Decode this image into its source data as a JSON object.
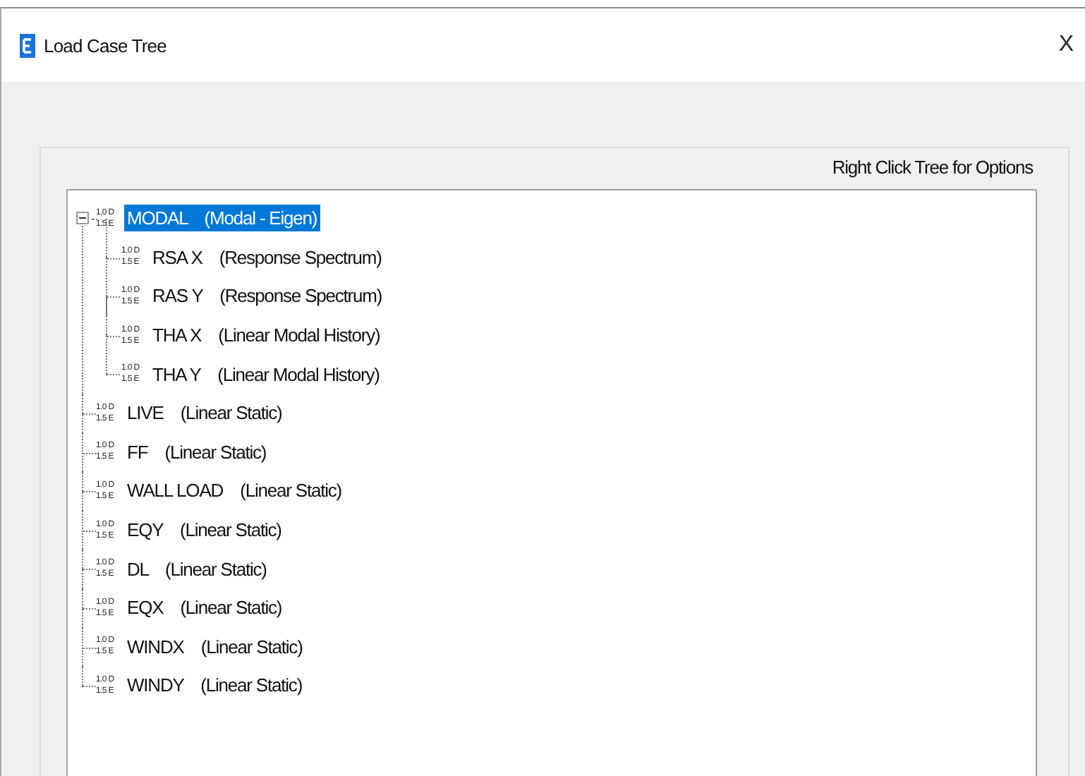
{
  "window": {
    "title": "Load Case Tree",
    "close": "X"
  },
  "hint": "Right Click  Tree for Options",
  "tree": [
    {
      "label": "MODAL    (Modal - Eigen)",
      "icon_top": "1.0 D",
      "icon_bottom": "1.5 E",
      "selected": true,
      "expanded": true,
      "children": [
        {
          "label": "RSA X    (Response Spectrum)",
          "icon_top": "1.0 D",
          "icon_bottom": "1.5 E",
          "selected": false
        },
        {
          "label": "RAS Y    (Response Spectrum)",
          "icon_top": "1.0 D",
          "icon_bottom": "1.5 E",
          "selected": false
        },
        {
          "label": "THA X    (Linear Modal History)",
          "icon_top": "1.0 D",
          "icon_bottom": "1.5 E",
          "selected": false
        },
        {
          "label": "THA Y    (Linear Modal History)",
          "icon_top": "1.0 D",
          "icon_bottom": "1.5 E",
          "selected": false
        }
      ]
    },
    {
      "label": "LIVE    (Linear Static)",
      "icon_top": "1.0 D",
      "icon_bottom": "1.5 E",
      "selected": false
    },
    {
      "label": "FF    (Linear Static)",
      "icon_top": "1.0 D",
      "icon_bottom": "1.5 E",
      "selected": false
    },
    {
      "label": "WALL LOAD    (Linear Static)",
      "icon_top": "1.0 D",
      "icon_bottom": "1.5 E",
      "selected": false
    },
    {
      "label": "EQY    (Linear Static)",
      "icon_top": "1.0 D",
      "icon_bottom": "1.5 E",
      "selected": false
    },
    {
      "label": "DL    (Linear Static)",
      "icon_top": "1.0 D",
      "icon_bottom": "1.5 E",
      "selected": false
    },
    {
      "label": "EQX    (Linear Static)",
      "icon_top": "1.0 D",
      "icon_bottom": "1.5 E",
      "selected": false
    },
    {
      "label": "WINDX    (Linear Static)",
      "icon_top": "1.0 D",
      "icon_bottom": "1.5 E",
      "selected": false
    },
    {
      "label": "WINDY    (Linear Static)",
      "icon_top": "1.0 D",
      "icon_bottom": "1.5 E",
      "selected": false
    }
  ]
}
